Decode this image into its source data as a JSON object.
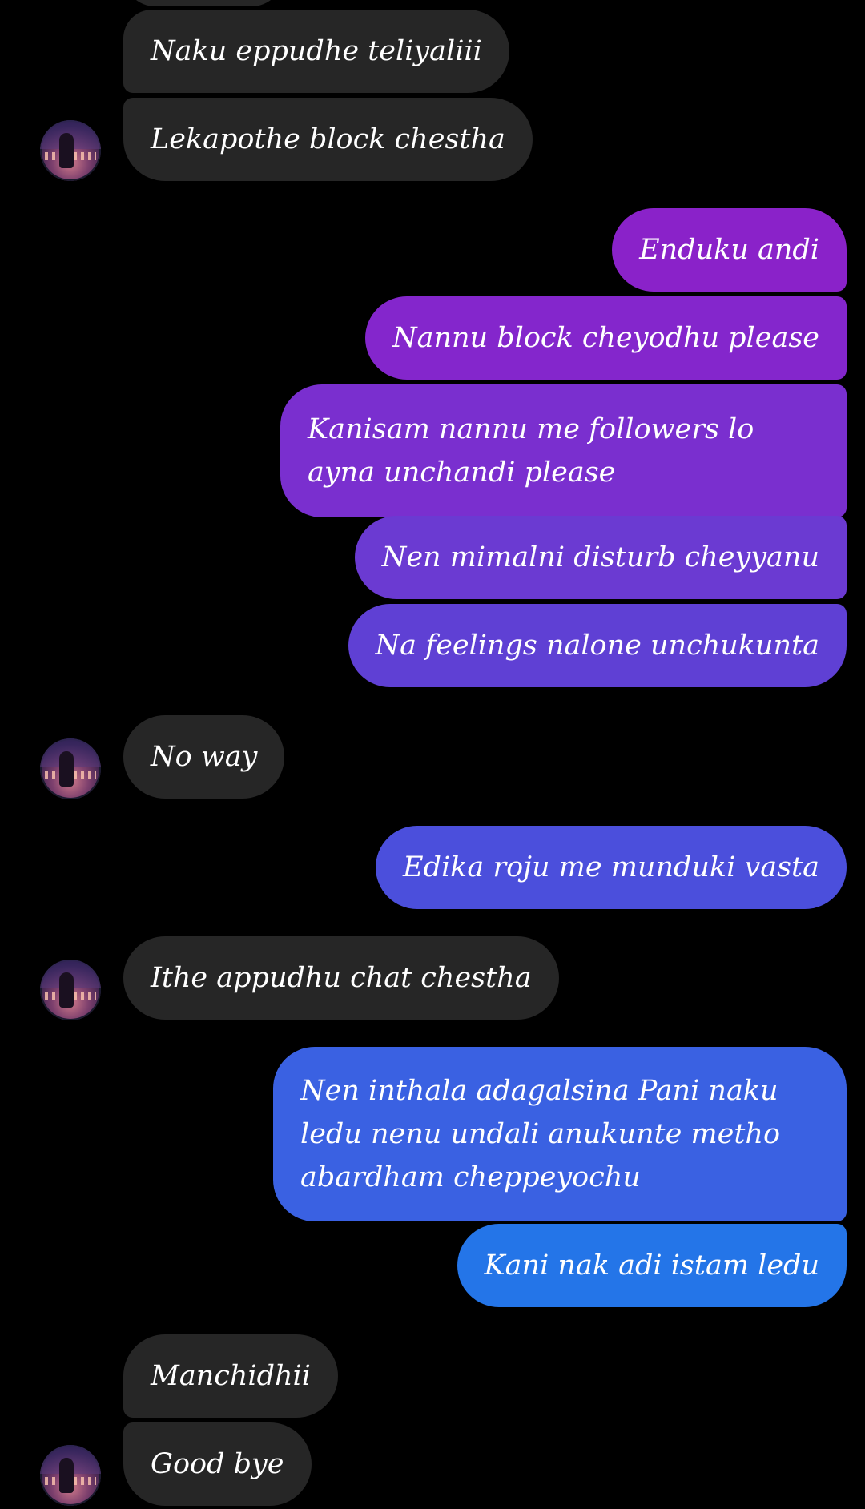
{
  "messages": [
    {
      "id": "m1",
      "dir": "in",
      "text": "Naku eppudhe teliyaliii"
    },
    {
      "id": "m2",
      "dir": "in",
      "text": "Lekapothe block chestha"
    },
    {
      "id": "m3",
      "dir": "out",
      "text": "Enduku andi"
    },
    {
      "id": "m4",
      "dir": "out",
      "text": "Nannu block cheyodhu please"
    },
    {
      "id": "m5",
      "dir": "out",
      "text": "Kanisam nannu me followers lo ayna unchandi please"
    },
    {
      "id": "m6",
      "dir": "out",
      "text": "Nen mimalni disturb cheyyanu"
    },
    {
      "id": "m7",
      "dir": "out",
      "text": "Na feelings nalone unchukunta"
    },
    {
      "id": "m8",
      "dir": "in",
      "text": "No way"
    },
    {
      "id": "m9",
      "dir": "out",
      "text": "Edika roju me munduki vasta"
    },
    {
      "id": "m10",
      "dir": "in",
      "text": "Ithe appudhu chat chestha"
    },
    {
      "id": "m11",
      "dir": "out",
      "text": "Nen inthala adagalsina Pani naku ledu nenu undali anukunte metho abardham cheppeyochu"
    },
    {
      "id": "m12",
      "dir": "out",
      "text": "Kani nak adi istam ledu"
    },
    {
      "id": "m13",
      "dir": "in",
      "text": "Manchidhii"
    },
    {
      "id": "m14",
      "dir": "in",
      "text": "Good bye"
    }
  ],
  "colors": {
    "incoming_bubble": "#262626",
    "outgoing_gradient_top": "#8a22c9",
    "outgoing_gradient_bottom": "#2078ea",
    "background": "#000000",
    "text": "#ffffff"
  },
  "icons": {
    "avatar": "contact-avatar-night-city"
  }
}
